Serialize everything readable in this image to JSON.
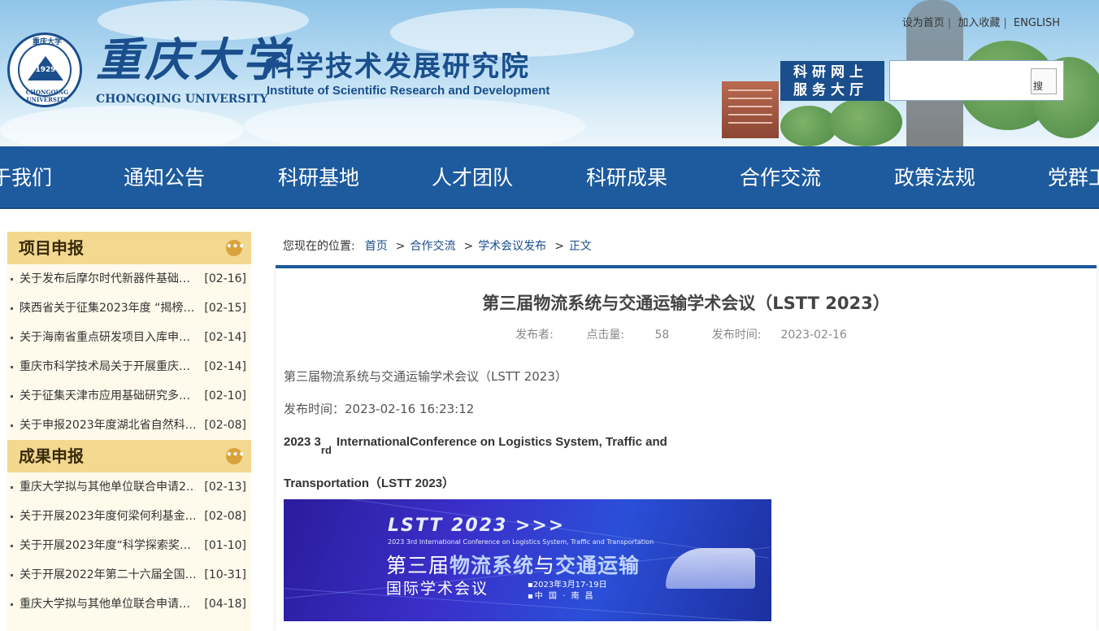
{
  "header": {
    "seal_top_text": "重庆大学",
    "seal_year": "1929",
    "seal_ring_text": "CHONGQING UNIVERSITY",
    "university_cn": "重庆大学",
    "university_en": "CHONGQING UNIVERSITY",
    "institute_cn": "科学技术发展研究院",
    "institute_en": "Institute of Scientific Research and Development",
    "top_links": [
      "设为首页",
      "加入收藏",
      "ENGLISH"
    ],
    "online_hall_line1": "科研网上",
    "online_hall_line2": "服务大厅",
    "search": {
      "value": "",
      "placeholder": "",
      "button_alt": "搜"
    }
  },
  "nav": {
    "items": [
      "关于我们",
      "通知公告",
      "科研基地",
      "人才团队",
      "科研成果",
      "合作交流",
      "政策法规",
      "党群工作"
    ]
  },
  "sidebar": {
    "sections": [
      {
        "title": "项目申报",
        "more_icon": "more-dots-icon",
        "items": [
          {
            "title": "关于发布后摩尔时代新器件基础…",
            "date": "[02-16]"
          },
          {
            "title": "陕西省关于征集2023年度 “揭榜…",
            "date": "[02-15]"
          },
          {
            "title": "关于海南省重点研发项目入库申…",
            "date": "[02-14]"
          },
          {
            "title": "重庆市科学技术局关于开展重庆…",
            "date": "[02-14]"
          },
          {
            "title": "关于征集天津市应用基础研究多…",
            "date": "[02-10]"
          },
          {
            "title": "关于申报2023年度湖北省自然科…",
            "date": "[02-08]"
          }
        ]
      },
      {
        "title": "成果申报",
        "more_icon": "more-dots-icon",
        "items": [
          {
            "title": "重庆大学拟与其他单位联合申请2…",
            "date": "[02-13]"
          },
          {
            "title": "关于开展2023年度何梁何利基金…",
            "date": "[02-08]"
          },
          {
            "title": "关于开展2023年度“科学探索奖…",
            "date": "[01-10]"
          },
          {
            "title": "关于开展2022年第二十六届全国…",
            "date": "[10-31]"
          },
          {
            "title": "重庆大学拟与其他单位联合申请…",
            "date": "[04-18]"
          }
        ]
      }
    ]
  },
  "breadcrumb": {
    "label": "您现在的位置:",
    "items": [
      "首页",
      "合作交流",
      "学术会议发布",
      "正文"
    ],
    "separator": ">"
  },
  "article": {
    "title": "第三届物流系统与交通运输学术会议（LSTT 2023）",
    "meta": {
      "publisher_label": "发布者:",
      "clicks_label": "点击量:",
      "clicks_value": "58",
      "time_label": "发布时间:",
      "time_value": "2023-02-16"
    },
    "para1": "第三届物流系统与交通运输学术会议（LSTT 2023）",
    "para2": "发布时间：2023-02-16 16:23:12",
    "en_line1_a": "2023 3",
    "en_line1_sub": "rd",
    "en_line1_b": " InternationalConference on Logistics System, Traffic and",
    "en_line2": "Transportation（LSTT 2023）",
    "banner": {
      "brand": "LSTT 2023 >>>",
      "subtitle": "2023 3rd International Conference on Logistics System, Traffic and Transportation",
      "cn_a": "第三届",
      "cn_b": "物流系统",
      "cn_c": "与",
      "cn_d": "交通运输",
      "cn_line2": "国际学术会议",
      "date": "▪2023年3月17-19日",
      "place": "▪中 国 · 南 昌"
    }
  }
}
